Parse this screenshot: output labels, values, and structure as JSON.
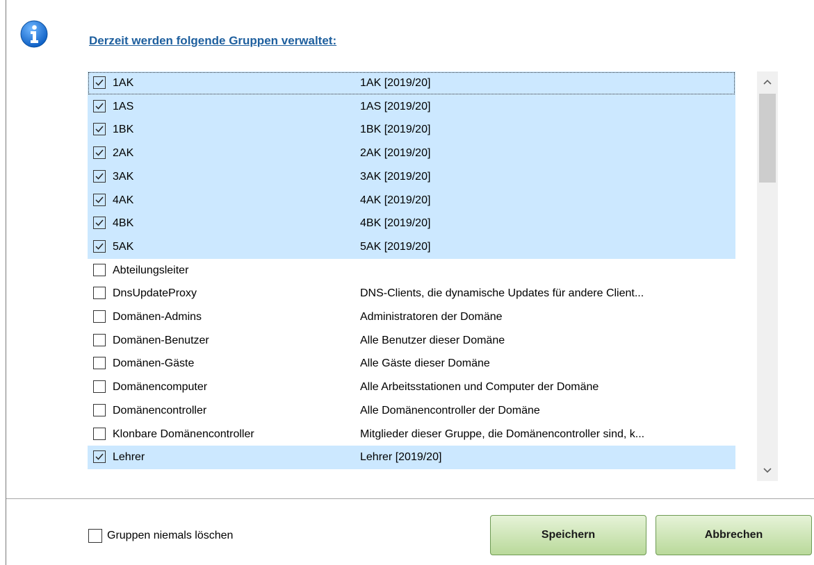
{
  "dialog": {
    "heading": "Derzeit werden folgende Gruppen verwaltet:",
    "accent_color": "#1e5f9e",
    "selected_row_color": "#cce8ff"
  },
  "groups": [
    {
      "name": "1AK",
      "description": "1AK [2019/20]",
      "checked": true
    },
    {
      "name": "1AS",
      "description": "1AS [2019/20]",
      "checked": true
    },
    {
      "name": "1BK",
      "description": "1BK [2019/20]",
      "checked": true
    },
    {
      "name": "2AK",
      "description": "2AK [2019/20]",
      "checked": true
    },
    {
      "name": "3AK",
      "description": "3AK [2019/20]",
      "checked": true
    },
    {
      "name": "4AK",
      "description": "4AK [2019/20]",
      "checked": true
    },
    {
      "name": "4BK",
      "description": "4BK [2019/20]",
      "checked": true
    },
    {
      "name": "5AK",
      "description": "5AK [2019/20]",
      "checked": true
    },
    {
      "name": "Abteilungsleiter",
      "description": "",
      "checked": false
    },
    {
      "name": "DnsUpdateProxy",
      "description": "DNS-Clients, die dynamische Updates für andere Client...",
      "checked": false
    },
    {
      "name": "Domänen-Admins",
      "description": "Administratoren der Domäne",
      "checked": false
    },
    {
      "name": "Domänen-Benutzer",
      "description": "Alle Benutzer dieser Domäne",
      "checked": false
    },
    {
      "name": "Domänen-Gäste",
      "description": "Alle Gäste dieser Domäne",
      "checked": false
    },
    {
      "name": "Domänencomputer",
      "description": "Alle Arbeitsstationen und Computer der Domäne",
      "checked": false
    },
    {
      "name": "Domänencontroller",
      "description": "Alle Domänencontroller der Domäne",
      "checked": false
    },
    {
      "name": "Klonbare Domänencontroller",
      "description": "Mitglieder dieser Gruppe, die Domänencontroller sind, k...",
      "checked": false
    },
    {
      "name": "Lehrer",
      "description": "Lehrer [2019/20]",
      "checked": true
    }
  ],
  "footer": {
    "never_delete_label": "Gruppen niemals löschen",
    "never_delete_checked": false,
    "save_label": "Speichern",
    "cancel_label": "Abbrechen"
  },
  "icons": {
    "info": "info-icon",
    "scroll_up": "chevron-up-icon",
    "scroll_down": "chevron-down-icon",
    "check": "check-icon"
  }
}
